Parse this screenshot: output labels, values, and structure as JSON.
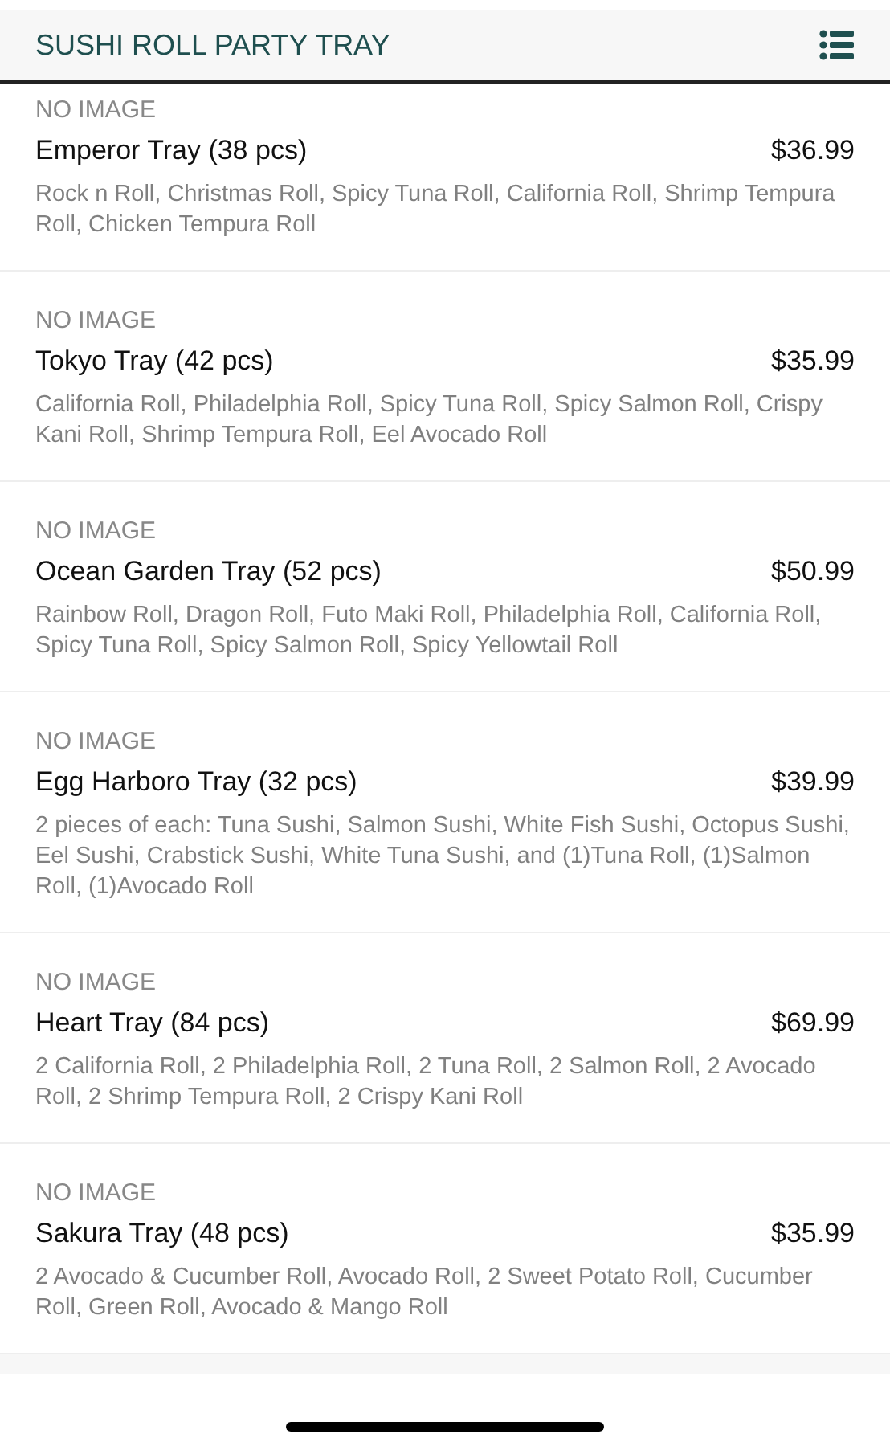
{
  "header": {
    "title": "SUSHI ROLL PARTY TRAY"
  },
  "items": [
    {
      "image_label": "NO IMAGE",
      "name": "Emperor Tray (38 pcs)",
      "price": "$36.99",
      "description": "Rock n Roll, Christmas Roll, Spicy Tuna Roll, California Roll, Shrimp Tempura Roll, Chicken Tempura Roll"
    },
    {
      "image_label": "NO IMAGE",
      "name": "Tokyo Tray (42 pcs)",
      "price": "$35.99",
      "description": "California Roll, Philadelphia Roll, Spicy Tuna Roll, Spicy Salmon Roll, Crispy Kani Roll, Shrimp Tempura Roll, Eel Avocado Roll"
    },
    {
      "image_label": "NO IMAGE",
      "name": "Ocean Garden Tray (52 pcs)",
      "price": "$50.99",
      "description": "Rainbow Roll, Dragon Roll, Futo Maki Roll, Philadelphia Roll, California Roll, Spicy Tuna Roll, Spicy Salmon Roll, Spicy Yellowtail Roll"
    },
    {
      "image_label": "NO IMAGE",
      "name": "Egg Harboro Tray (32 pcs)",
      "price": "$39.99",
      "description": "2 pieces of each: Tuna Sushi, Salmon Sushi, White Fish Sushi, Octopus Sushi, Eel Sushi, Crabstick Sushi, White Tuna Sushi, and (1)Tuna Roll, (1)Salmon Roll, (1)Avocado Roll"
    },
    {
      "image_label": "NO IMAGE",
      "name": "Heart Tray (84 pcs)",
      "price": "$69.99",
      "description": "2 California Roll, 2 Philadelphia Roll, 2 Tuna Roll, 2 Salmon Roll, 2 Avocado Roll, 2 Shrimp Tempura Roll, 2 Crispy Kani Roll"
    },
    {
      "image_label": "NO IMAGE",
      "name": "Sakura Tray (48 pcs)",
      "price": "$35.99",
      "description": "2 Avocado & Cucumber Roll, Avocado Roll, 2 Sweet Potato Roll, Cucumber Roll, Green Roll, Avocado & Mango Roll"
    }
  ]
}
